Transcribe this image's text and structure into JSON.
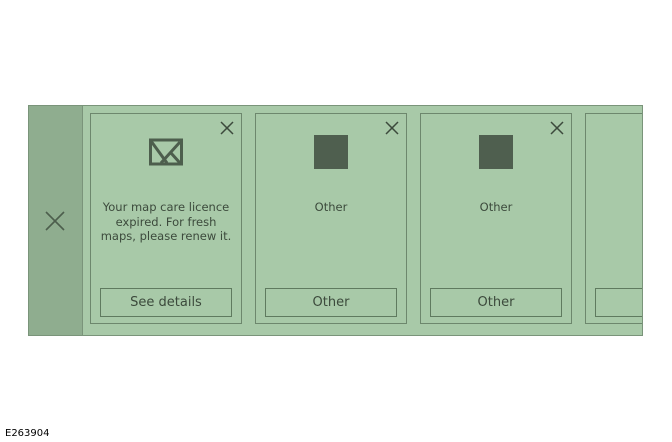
{
  "panel": {
    "background": "#a8c9a8",
    "side_close_icon": "close-icon",
    "cards": [
      {
        "icon": "map-icon",
        "text": "Your map care licence\nexpired. For fresh\nmaps, please renew it.",
        "button_label": "See details",
        "close_icon": "close-icon"
      },
      {
        "icon": "placeholder-square-icon",
        "text": "Other",
        "button_label": "Other",
        "close_icon": "close-icon"
      },
      {
        "icon": "placeholder-square-icon",
        "text": "Other",
        "button_label": "Other",
        "close_icon": "close-icon"
      }
    ]
  },
  "figure_id": "E263904"
}
